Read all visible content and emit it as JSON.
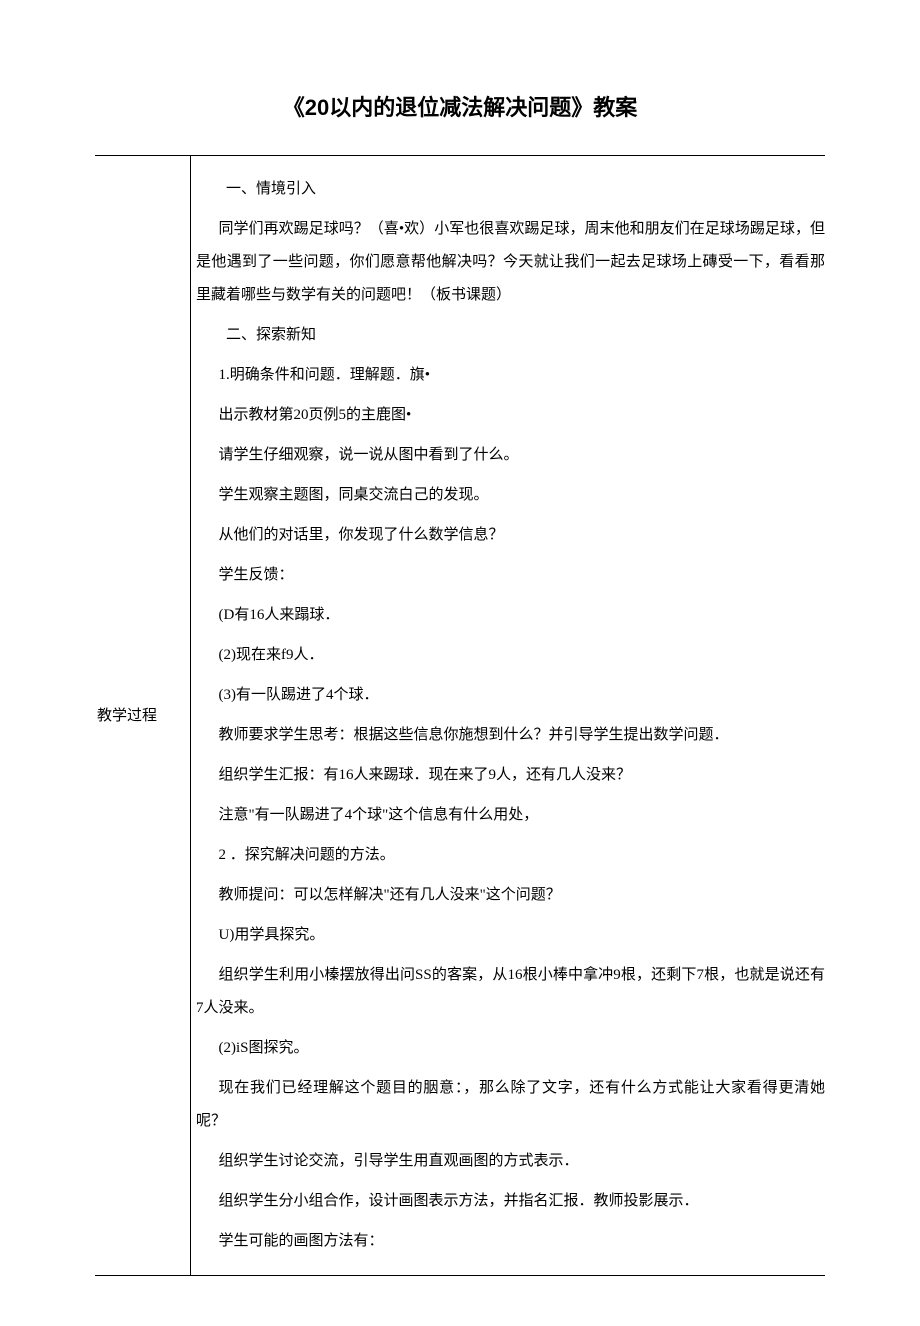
{
  "title": "《20以内的退位减法解决问题》教案",
  "sidebar_label": "教学过程",
  "content": {
    "s1_heading": "一、情境引入",
    "s1_p1": "同学们再欢踢足球吗？（喜•欢）小军也很喜欢踢足球，周末他和朋友们在足球场踢足球，但是他遇到了一些问题，你们愿意帮他解决吗？今天就让我们一起去足球场上磚受一下，看看那里藏着哪些与数学有关的问题吧！（板书课题）",
    "s2_heading": "二、探索新知",
    "s2_p1": "1.明确条件和问题．理解题．旗•",
    "s2_p2": "出示教材第20页例5的主鹿图•",
    "s2_p3": "请学生仔细观察，说一说从图中看到了什么。",
    "s2_p4": "学生观察主题图，同桌交流白己的发现。",
    "s2_p5": "从他们的对话里，你发现了什么数学信息？",
    "s2_p6": "学生反馈：",
    "s2_p7": "(D有16人来蹋球．",
    "s2_p8": "(2)现在来f9人．",
    "s2_p9": "(3)有一队踢进了4个球．",
    "s2_p10": "教师要求学生思考：根据这些信息你施想到什么？并引导学生提出数学问题．",
    "s2_p11": "组织学生汇报：有16人来踢球．现在来了9人，还有几人没来？",
    "s2_p12": "注意\"有一队踢进了4个球\"这个信息有什么用处，",
    "s2_p13": "2   ．探究解决问题的方法。",
    "s2_p14": "教师提问：可以怎样解决\"还有几人没来\"这个问题？",
    "s2_p15": "U)用学具探究。",
    "s2_p16": "组织学生利用小榛摆放得出问SS的客案，从16根小棒中拿冲9根，还剩下7根，也就是说还有7人没来。",
    "s2_p17": "(2)iS图探究。",
    "s2_p18": "现在我们已经理解这个题目的胭意：，那么除了文字，还有什么方式能让大家看得更清她呢？",
    "s2_p19": "组织学生讨论交流，引导学生用直观画图的方式表示．",
    "s2_p20": "组织学生分小组合作，设计画图表示方法，并指名汇报．教师投影展示．",
    "s2_p21": "学生可能的画图方法有："
  }
}
